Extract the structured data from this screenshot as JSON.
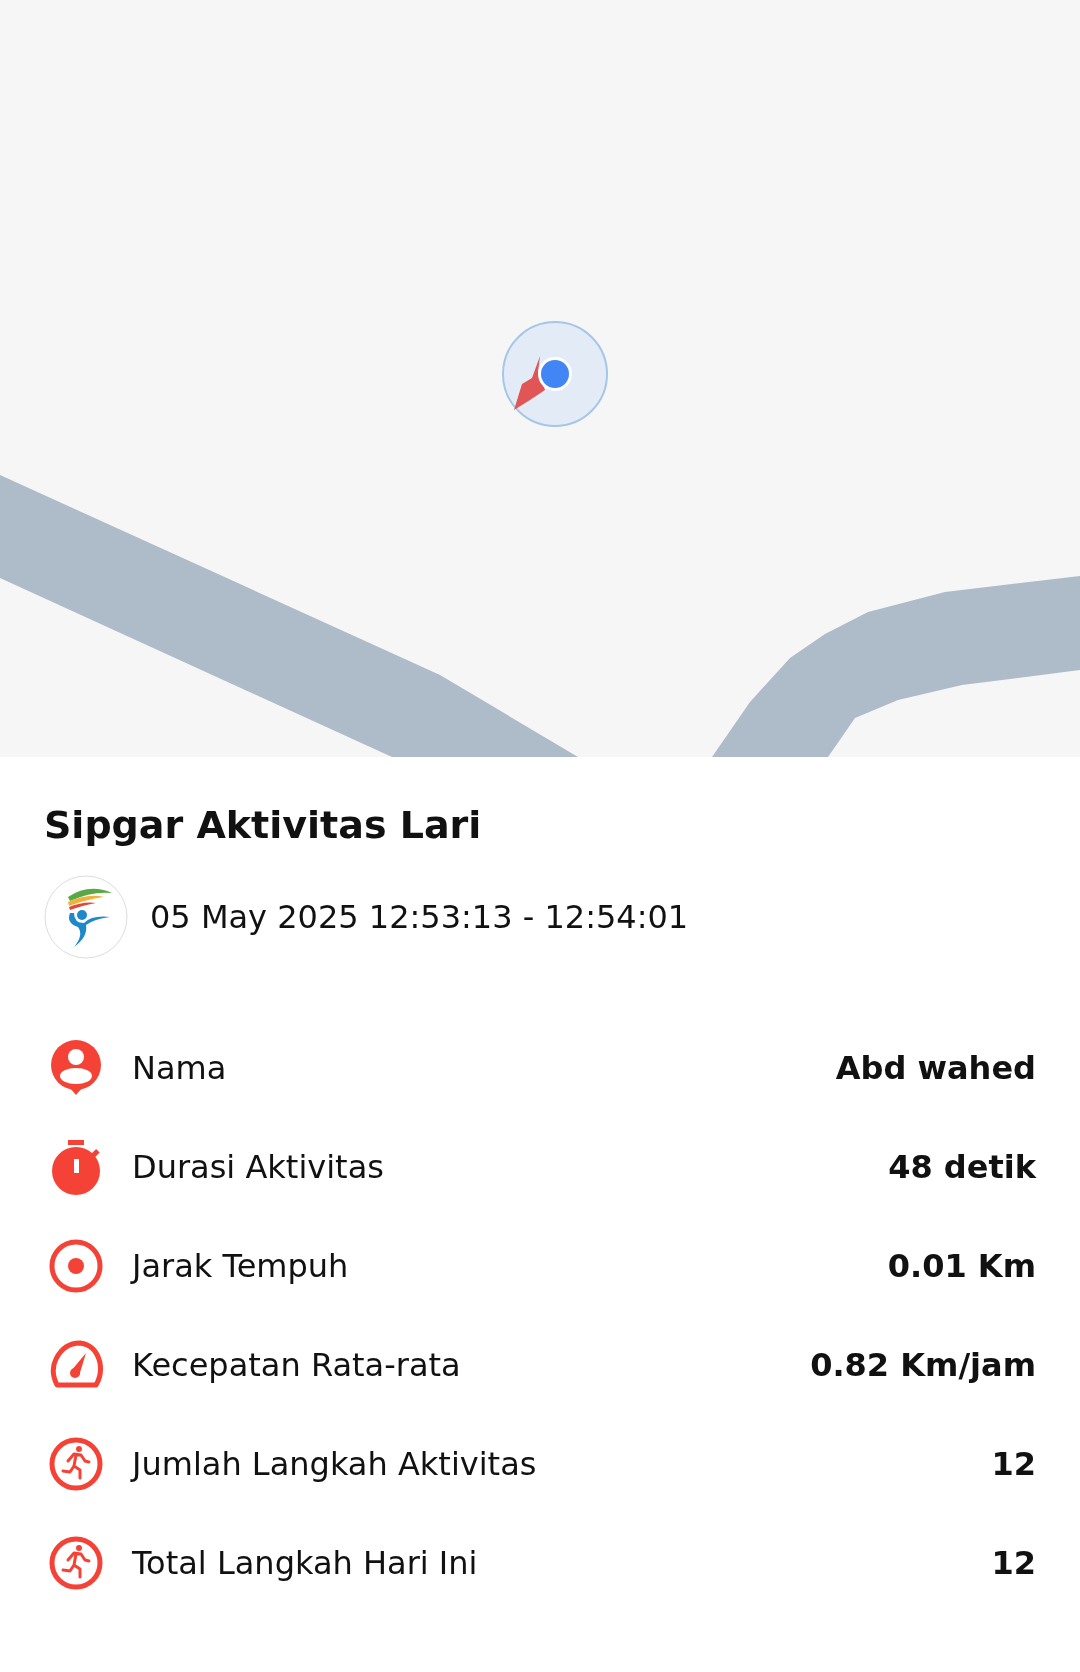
{
  "activity": {
    "title": "Sipgar Aktivitas Lari",
    "datetime": "05 May 2025 12:53:13 - 12:54:01"
  },
  "stats": [
    {
      "kind": "person",
      "label": "Nama",
      "value": "Abd wahed"
    },
    {
      "kind": "stopwatch",
      "label": "Durasi Aktivitas",
      "value": "48 detik"
    },
    {
      "kind": "target",
      "label": "Jarak Tempuh",
      "value": "0.01 Km"
    },
    {
      "kind": "gauge",
      "label": "Kecepatan Rata-rata",
      "value": "0.82 Km/jam"
    },
    {
      "kind": "runner",
      "label": "Jumlah Langkah Aktivitas",
      "value": "12"
    },
    {
      "kind": "runner",
      "label": "Total Langkah Hari Ini",
      "value": "12"
    }
  ]
}
